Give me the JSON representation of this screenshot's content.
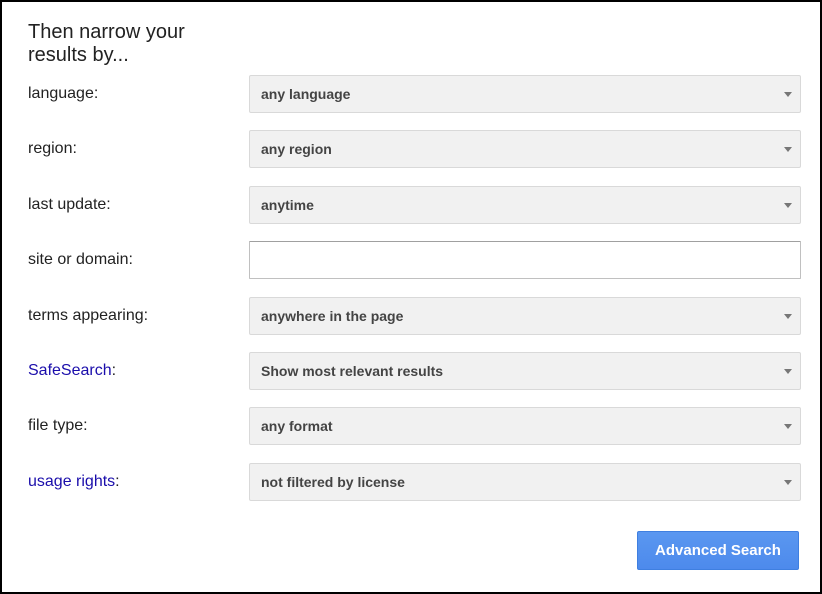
{
  "section": {
    "title": "Then narrow your results by..."
  },
  "fields": [
    {
      "label": "language",
      "suffix": ":",
      "is_link": false,
      "type": "select",
      "value": "any language"
    },
    {
      "label": "region",
      "suffix": ":",
      "is_link": false,
      "type": "select",
      "value": "any region"
    },
    {
      "label": "last update",
      "suffix": ":",
      "is_link": false,
      "type": "select",
      "value": "anytime"
    },
    {
      "label": "site or domain",
      "suffix": ":",
      "is_link": false,
      "type": "text",
      "value": "",
      "placeholder": ""
    },
    {
      "label": "terms appearing",
      "suffix": ":",
      "is_link": false,
      "type": "select",
      "value": "anywhere in the page"
    },
    {
      "label": "SafeSearch",
      "suffix": ":",
      "is_link": true,
      "type": "select",
      "value": "Show most relevant results"
    },
    {
      "label": "file type",
      "suffix": ":",
      "is_link": false,
      "type": "select",
      "value": "any format"
    },
    {
      "label": "usage rights",
      "suffix": ":",
      "is_link": true,
      "type": "select",
      "value": "not filtered by license"
    }
  ],
  "actions": {
    "submit_label": "Advanced Search"
  },
  "colors": {
    "link": "#1a0dab",
    "button": "#4d90fe",
    "select_bg": "#f1f1f1"
  }
}
